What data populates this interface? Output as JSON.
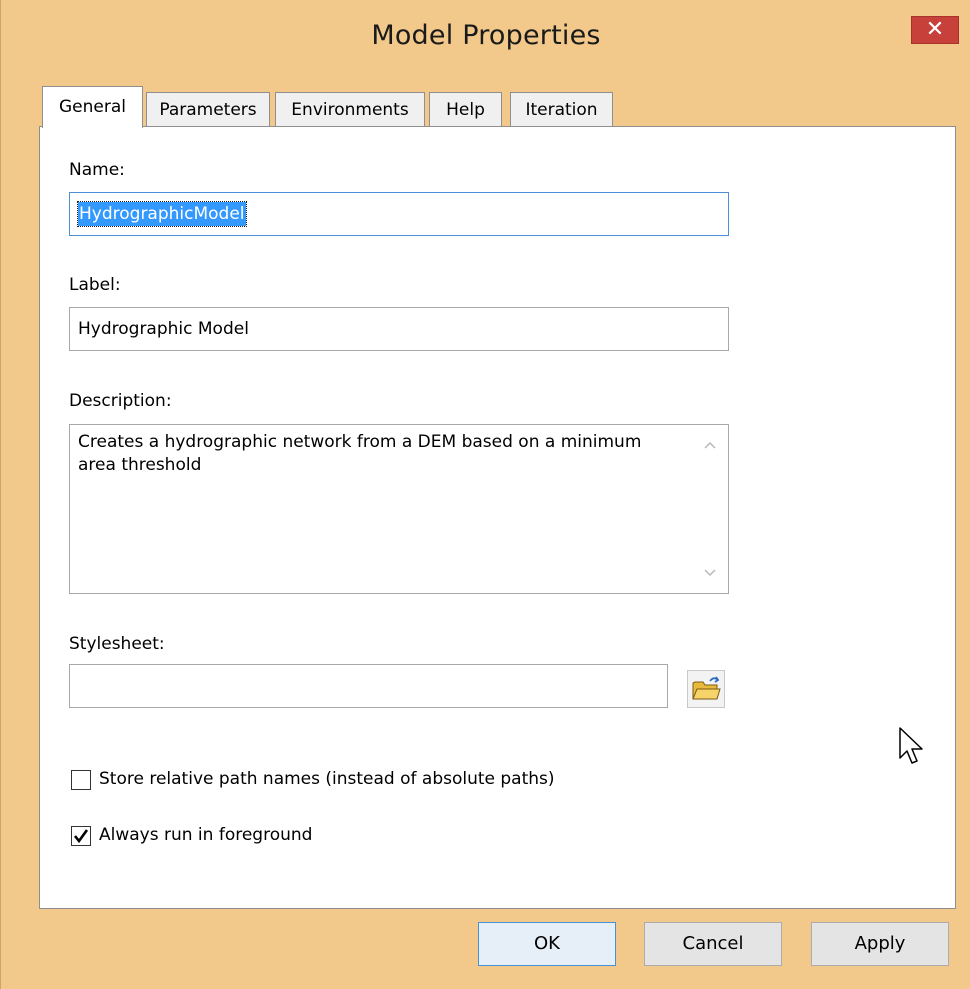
{
  "window": {
    "title": "Model Properties",
    "close_glyph": "✕"
  },
  "tabs": [
    {
      "label": "General",
      "active": true
    },
    {
      "label": "Parameters"
    },
    {
      "label": "Environments"
    },
    {
      "label": "Help"
    },
    {
      "label": "Iteration"
    }
  ],
  "general": {
    "name_label": "Name:",
    "name_value": "HydrographicModel",
    "label_label": "Label:",
    "label_value": "Hydrographic Model",
    "description_label": "Description:",
    "description_value": "Creates a hydrographic network from a DEM based on a minimum area threshold",
    "stylesheet_label": "Stylesheet:",
    "stylesheet_value": "",
    "browse_icon": "open-folder-icon",
    "store_relative_label": "Store relative path names (instead of absolute paths)",
    "store_relative_checked": false,
    "foreground_label": "Always run in foreground",
    "foreground_checked": true
  },
  "buttons": {
    "ok": "OK",
    "cancel": "Cancel",
    "apply": "Apply"
  },
  "colors": {
    "title_bar": "#f2c98a",
    "close": "#c7413a",
    "selection": "#3399ff"
  }
}
